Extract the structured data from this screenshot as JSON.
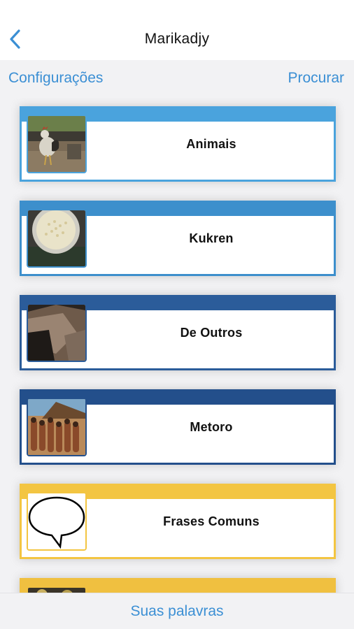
{
  "navbar": {
    "back_icon": "chevron-left-icon",
    "title": "Marikadjy"
  },
  "toolbar": {
    "left_label": "Configurações",
    "right_label": "Procurar"
  },
  "categories": [
    {
      "label": "Animais",
      "color": "#4aa3dd",
      "thumb": "rooster-photo"
    },
    {
      "label": "Kukren",
      "color": "#3d8fcc",
      "thumb": "grain-bowl-photo"
    },
    {
      "label": "De Outros",
      "color": "#2b5c9a",
      "thumb": "rock-photo"
    },
    {
      "label": "Metoro",
      "color": "#234f8b",
      "thumb": "people-gathering-photo"
    },
    {
      "label": "Frases Comuns",
      "color": "#f3c542",
      "thumb": "speech-bubble-icon"
    },
    {
      "label": "",
      "color": "#f0c040",
      "thumb": "partial-photo"
    }
  ],
  "bottom_bar": {
    "label": "Suas palavras"
  },
  "colors": {
    "accent": "#3b8fd4",
    "background": "#f2f2f4"
  }
}
